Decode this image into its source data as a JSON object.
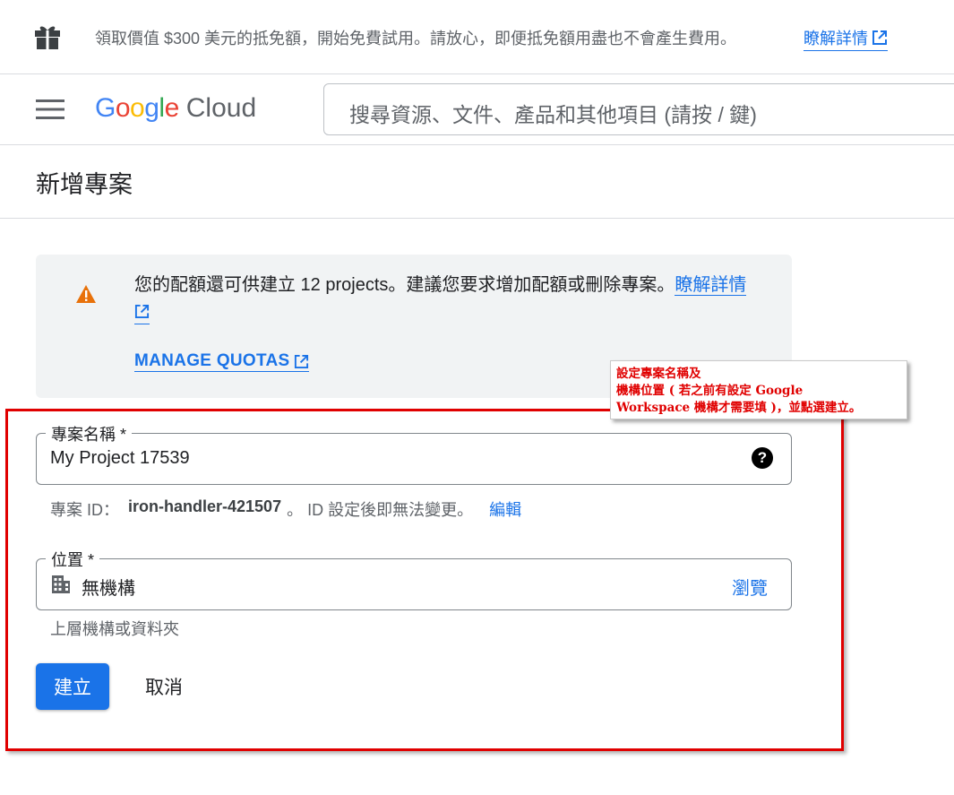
{
  "promo": {
    "icon": "gift-icon",
    "text": "領取價值 $300 美元的抵免額，開始免費試用。請放心，即便抵免額用盡也不會產生費用。",
    "link_label": "瞭解詳情"
  },
  "header": {
    "logo_google": "Google",
    "logo_cloud": "Cloud",
    "search_placeholder": "搜尋資源、文件、產品和其他項目 (請按 / 鍵)"
  },
  "page": {
    "title": "新增專案"
  },
  "notice": {
    "message": "您的配額還可供建立 12 projects。建議您要求增加配額或刪除專案。",
    "learn_more": "瞭解詳情",
    "manage_quotas": "MANAGE QUOTAS"
  },
  "annotation": {
    "line1": "設定專案名稱及",
    "line2": "機構位置 ( 若之前有設定 Google",
    "line3": "Workspace 機構才需要填 )，並點選建立。"
  },
  "form": {
    "project_name_label": "專案名稱 *",
    "project_name_value": "My Project 17539",
    "project_id_prefix": "專案 ID：",
    "project_id_value": "iron-handler-421507",
    "project_id_suffix": "。 ID 設定後即無法變更。",
    "edit_label": "編輯",
    "location_label": "位置 *",
    "location_value": "無機構",
    "browse_label": "瀏覽",
    "location_hint": "上層機構或資料夾",
    "create_label": "建立",
    "cancel_label": "取消"
  },
  "colors": {
    "primary": "#1a73e8",
    "warning": "#e8710a",
    "annotation_red": "#e00000",
    "notice_bg": "#f1f3f4"
  }
}
